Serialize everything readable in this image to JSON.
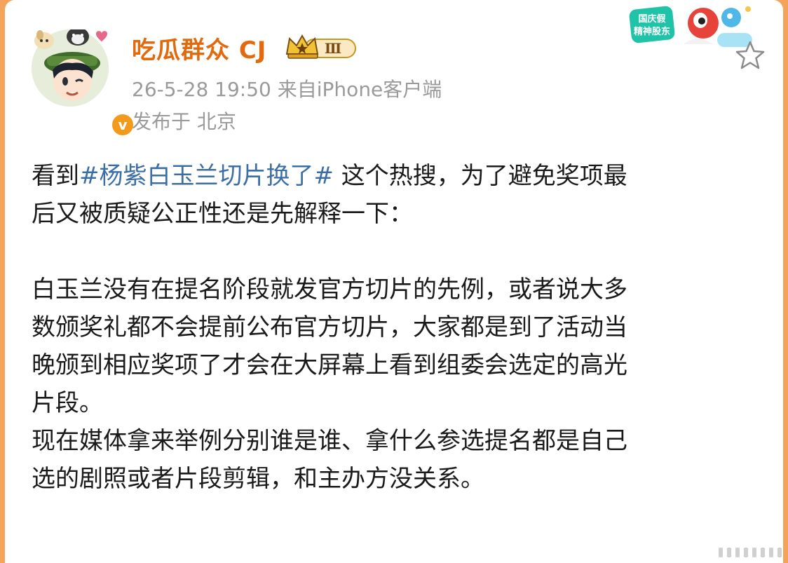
{
  "user": {
    "name": "吃瓜群众 CJ",
    "level_badge": "Ⅲ",
    "meta": "26-5-28 19:50  来自iPhone客户端",
    "location": "发布于 北京"
  },
  "campaign_badge": {
    "line1": "国庆假",
    "line2": "精神股东"
  },
  "post": {
    "prefix": "看到",
    "hashtag": "#杨紫白玉兰切片换了#",
    "line1_rest": " 这个热搜，为了避免奖项最",
    "line2": "后又被质疑公正性还是先解释一下：",
    "para2": [
      "白玉兰没有在提名阶段就发官方切片的先例，或者说大多",
      "数颁奖礼都不会提前公布官方切片，大家都是到了活动当",
      "晚颁到相应奖项了才会在大屏幕上看到组委会选定的高光",
      "片段。",
      "现在媒体拿来举例分别谁是谁、拿什么参选提名都是自己",
      "选的剧照或者片段剪辑，和主办方没关系。"
    ]
  },
  "colors": {
    "name": "#e26a0c",
    "hashtag": "#3a6ea5",
    "meta": "#9a9a9a",
    "frame": "#f3a35a"
  },
  "icons": [
    "avatar",
    "verified-badge-icon",
    "crown-level-icon",
    "campaign-badge-icon",
    "favorite-star-icon"
  ]
}
